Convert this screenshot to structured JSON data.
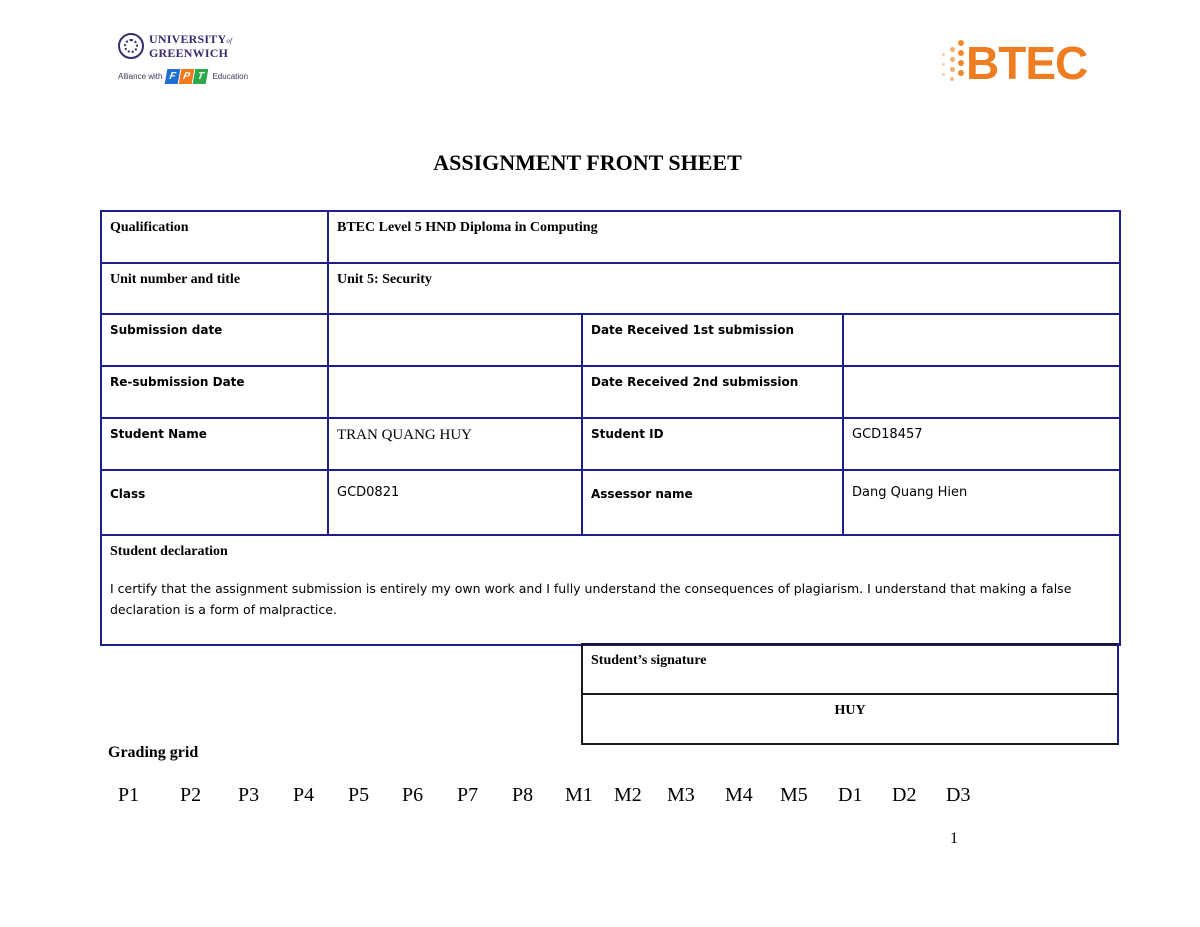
{
  "header": {
    "university_logo": {
      "line1": "UNIVERSITY",
      "of": "of",
      "line2": "GREENWICH",
      "alliance_prefix": "Alliance with",
      "fpt_letters": [
        "F",
        "P",
        "T"
      ],
      "fpt_colors": [
        "#1f6fd1",
        "#f07a1c",
        "#2aa84a"
      ],
      "alliance_suffix": "Education",
      "brand_color": "#3b2a6e"
    },
    "btec_logo": {
      "text": "BTEC",
      "brand_color": "#ee7d21"
    }
  },
  "title": "ASSIGNMENT FRONT SHEET",
  "form": {
    "qualification": {
      "label": "Qualification",
      "value": "BTEC Level 5 HND Diploma in Computing"
    },
    "unit": {
      "label": "Unit number and title",
      "value": "Unit 5: Security"
    },
    "submission_date": {
      "label": "Submission date",
      "value": ""
    },
    "date_received_1": {
      "label": "Date Received 1st submission",
      "value": ""
    },
    "resubmission_date": {
      "label": "Re-submission Date",
      "value": ""
    },
    "date_received_2": {
      "label": "Date Received 2nd submission",
      "value": ""
    },
    "student_name": {
      "label": "Student Name",
      "value": "TRAN QUANG HUY"
    },
    "student_id": {
      "label": "Student ID",
      "value": "GCD18457"
    },
    "class": {
      "label": "Class",
      "value": "GCD0821"
    },
    "assessor": {
      "label": "Assessor name",
      "value": "Dang Quang Hien"
    },
    "declaration": {
      "title": "Student declaration",
      "text": "I certify that the assignment submission is entirely my own work and I fully understand the consequences of plagiarism. I understand that making a false declaration is a form of malpractice."
    },
    "signature": {
      "label": "Student’s signature",
      "value": "HUY"
    },
    "border_color": "#1e1e8c"
  },
  "grading": {
    "title": "Grading grid",
    "criteria": [
      "P1",
      "P2",
      "P3",
      "P4",
      "P5",
      "P6",
      "P7",
      "P8",
      "M1",
      "M2",
      "M3",
      "M4",
      "M5",
      "D1",
      "D2",
      "D3"
    ]
  },
  "page_number": "1"
}
